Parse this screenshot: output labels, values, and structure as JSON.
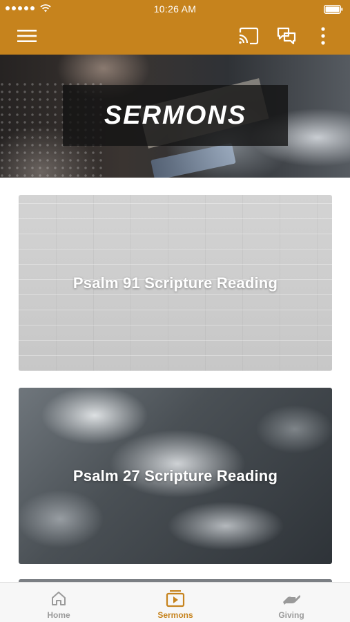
{
  "status_bar": {
    "time": "10:26 AM",
    "signal_icon": "signal-dots-icon",
    "wifi_icon": "wifi-icon",
    "battery_icon": "battery-icon"
  },
  "app_bar": {
    "menu_icon": "hamburger-menu-icon",
    "cast_icon": "cast-icon",
    "chat_icon": "chat-icon",
    "more_icon": "more-vertical-icon",
    "color": "#c6831d"
  },
  "hero": {
    "title": "SERMONS"
  },
  "sermons": [
    {
      "title": "Psalm 91 Scripture Reading"
    },
    {
      "title": "Psalm 27 Scripture Reading"
    }
  ],
  "bottom_nav": {
    "items": [
      {
        "label": "Home",
        "icon": "home-icon",
        "active": false
      },
      {
        "label": "Sermons",
        "icon": "sermons-play-icon",
        "active": true
      },
      {
        "label": "Giving",
        "icon": "giving-hand-icon",
        "active": false
      }
    ],
    "active_color": "#c6831d",
    "inactive_color": "#9a9a9a"
  }
}
